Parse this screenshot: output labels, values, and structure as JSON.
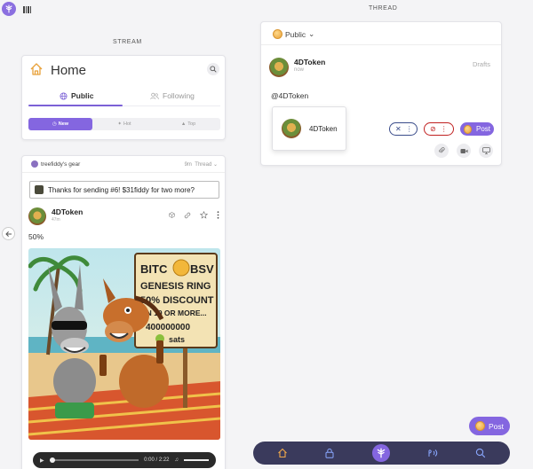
{
  "headers": {
    "thread": "THREAD",
    "stream": "STREAM"
  },
  "home": {
    "title": "Home",
    "tabs": [
      {
        "label": "Public"
      },
      {
        "label": "Following"
      }
    ],
    "sort": [
      {
        "label": "New"
      },
      {
        "label": "Hot"
      },
      {
        "label": "Top"
      }
    ]
  },
  "post": {
    "context_label": "treefiddy's gear",
    "age": "9m",
    "thread_label": "Thread",
    "reply_text": "Thanks for sending #6! $31fiddy for two more?",
    "author": "4DToken",
    "author_time": "47m",
    "body": "50%",
    "image": {
      "sign_line1": "BITC",
      "sign_line1b": "BSV",
      "sign_line2": "GENESIS RING",
      "sign_line3": "50% DISCOUNT",
      "sign_line4": "ON 10 OR MORE...",
      "sign_line5": "400000000",
      "sign_line6": "sats"
    },
    "audio": {
      "current": "0:00",
      "total": "2:22"
    }
  },
  "thread": {
    "visibility": "Public",
    "author": "4DToken",
    "author_time": "now",
    "drafts_label": "Drafts",
    "mention_text": "@4DToken",
    "suggestion_name": "4DToken",
    "post_label": "Post"
  },
  "float_post_label": "Post",
  "colors": {
    "accent": "#8466e0",
    "nav_bg": "#3a3a5c",
    "link_blue": "#3a4c8a",
    "warn_red": "#c02020"
  }
}
